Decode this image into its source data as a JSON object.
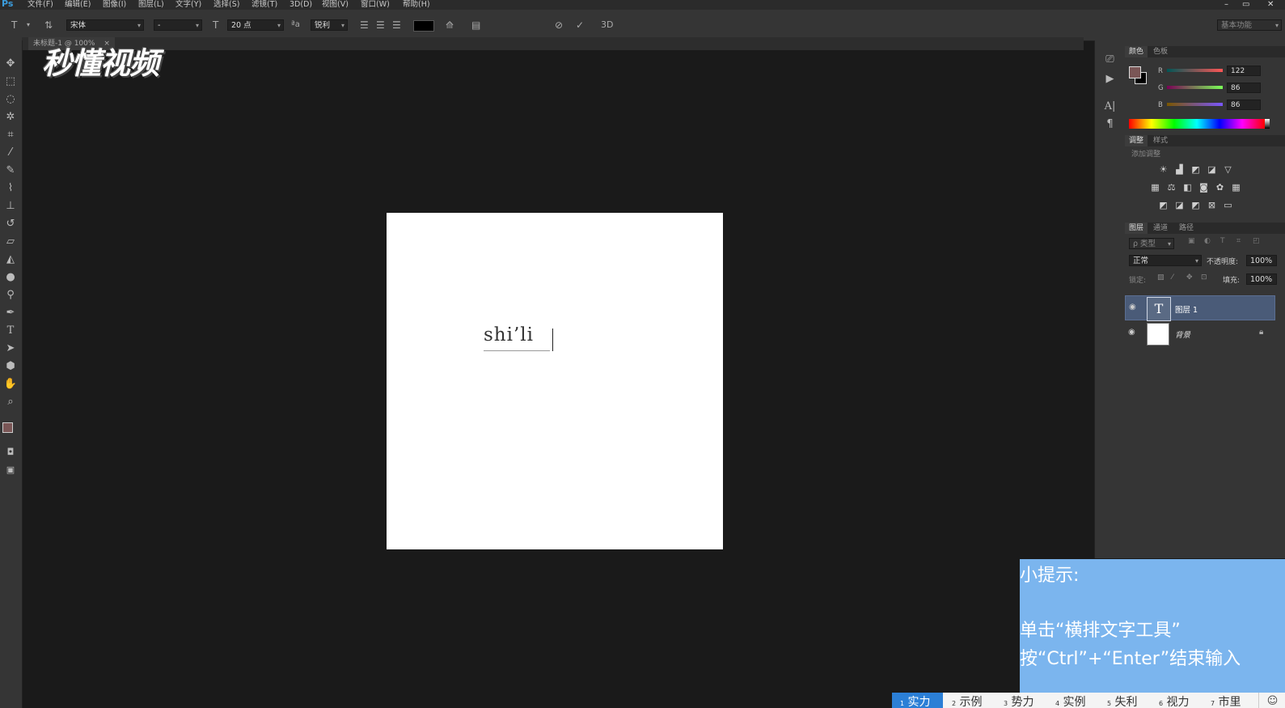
{
  "menubar": {
    "app_logo": "Ps",
    "items": [
      "文件(F)",
      "编辑(E)",
      "图像(I)",
      "图层(L)",
      "文字(Y)",
      "选择(S)",
      "滤镜(T)",
      "3D(D)",
      "视图(V)",
      "窗口(W)",
      "帮助(H)"
    ],
    "window_controls": [
      "–",
      "▭",
      "✕"
    ]
  },
  "options": {
    "font_family": "宋体",
    "font_style": "-",
    "font_size": "20 点",
    "aa_label": "ªa",
    "antialias": "锐利",
    "threed": "3D",
    "workspace": "基本功能"
  },
  "tabs": {
    "doc_tab": "未标题-1 @ 100%"
  },
  "canvas": {
    "typed_text": "shi’li"
  },
  "logo": {
    "text": "秒懂视频"
  },
  "color_panel": {
    "tabs": [
      "颜色",
      "色板"
    ],
    "r_label": "R",
    "r_value": "122",
    "g_label": "G",
    "g_value": "86",
    "b_label": "B",
    "b_value": "86",
    "foreground": "#7a5656"
  },
  "adjust_panel": {
    "tabs": [
      "调整",
      "样式"
    ],
    "title": "添加调整"
  },
  "layers_panel": {
    "tabs": [
      "图层",
      "通道",
      "路径"
    ],
    "filter": "ρ 类型",
    "blend_mode": "正常",
    "opacity_label": "不透明度:",
    "opacity": "100%",
    "lock_label": "锁定:",
    "fill_label": "填充:",
    "fill": "100%",
    "layers": [
      {
        "name": "图层 1",
        "thumb": "T"
      },
      {
        "name": "背景",
        "thumb": ""
      }
    ]
  },
  "tip": {
    "heading": "小提示:",
    "line1": "单击“横排文字工具”",
    "line2": "按“Ctrl”+“Enter”结束输入"
  },
  "steps": [
    {
      "num": "1",
      "label": "实力"
    },
    {
      "num": "2",
      "label": "示例"
    },
    {
      "num": "3",
      "label": "势力"
    },
    {
      "num": "4",
      "label": "实例"
    },
    {
      "num": "5",
      "label": "失利"
    },
    {
      "num": "6",
      "label": "视力"
    },
    {
      "num": "7",
      "label": "市里"
    }
  ]
}
